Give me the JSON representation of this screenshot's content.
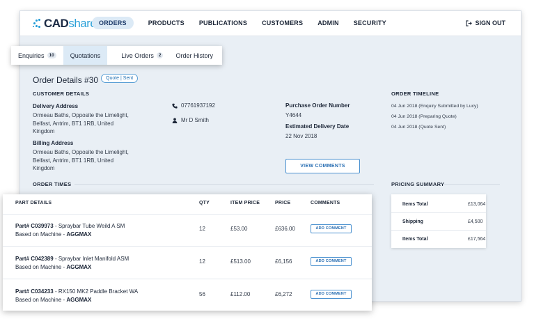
{
  "brand": {
    "name_bold": "CAD",
    "name_light": "share"
  },
  "nav": {
    "items": [
      {
        "label": "ORDERS",
        "active": true
      },
      {
        "label": "PRODUCTS"
      },
      {
        "label": "PUBLICATIONS"
      },
      {
        "label": "CUSTOMERS"
      },
      {
        "label": "ADMIN"
      },
      {
        "label": "SECURITY"
      }
    ],
    "signout": "SIGN OUT"
  },
  "tabs": [
    {
      "label": "Enquiries",
      "count": "10"
    },
    {
      "label": "Quotations",
      "active": true
    },
    {
      "label": "Live Orders",
      "count": "2"
    },
    {
      "label": "Order History"
    }
  ],
  "order": {
    "title": "Order Details #30",
    "status": "Quote | Sent",
    "customer_details_label": "CUSTOMER DETAILS",
    "delivery_label": "Delivery Address",
    "delivery_lines": [
      "Ormeau Baths, Opposite the Limelight,",
      "Belfast, Antrim, BT1 1RB, United",
      "Kingdom"
    ],
    "billing_label": "Billing Address",
    "billing_lines": [
      "Ormeau Baths, Opposite the Limelight,",
      "Belfast, Antrim, BT1 1RB, United",
      "Kingdom"
    ],
    "phone": "07761937192",
    "contact_name": "Mr D Smith",
    "po_label": "Purchase Order Number",
    "po_value": "Y4644",
    "edd_label": "Estimated Delivery Date",
    "edd_value": "22 Nov 2018",
    "view_comments": "VIEW COMMENTS",
    "order_times_label": "ORDER TIMES",
    "timeline_label": "ORDER TIMELINE",
    "timeline": [
      "04 Jun 2018 (Enquiry Submitted by Lucy)",
      "04 Jun 2018 (Preparing Quote)",
      "04 Jun 2018 (Quote Sent)"
    ]
  },
  "pricing": {
    "label": "PRICING SUMMARY",
    "rows": [
      {
        "key": "Items Total",
        "value": "£13,064"
      },
      {
        "key": "Shipping",
        "value": "£4,500"
      },
      {
        "key": "Items Total",
        "value": "£17,564"
      }
    ]
  },
  "parts_table": {
    "headers": {
      "part": "PART DETAILS",
      "qty": "QTY",
      "item_price": "ITEM PRICE",
      "price": "PRICE",
      "comments": "COMMENTS"
    },
    "rows": [
      {
        "part_no": "Part# C039973",
        "desc": " - Spraybar Tube Weild A SM",
        "machine_prefix": "Based on Machine - ",
        "machine": "AGGMAX",
        "qty": "12",
        "item_price": "£53.00",
        "price": "£636.00",
        "action": "ADD COMMENT"
      },
      {
        "part_no": "Part# C042389",
        "desc": " - Spraybar Inlet Manifold ASM",
        "machine_prefix": "Based on Machine - ",
        "machine": "AGGMAX",
        "qty": "12",
        "item_price": "£513.00",
        "price": "£6,156",
        "action": "ADD COMMENT"
      },
      {
        "part_no": "Part# C034233",
        "desc": " - RX150 MK2 Paddle Bracket WA",
        "machine_prefix": "Based on Machine - ",
        "machine": "AGGMAX",
        "qty": "56",
        "item_price": "£112.00",
        "price": "£6,272",
        "action": "ADD COMMENT"
      }
    ]
  }
}
